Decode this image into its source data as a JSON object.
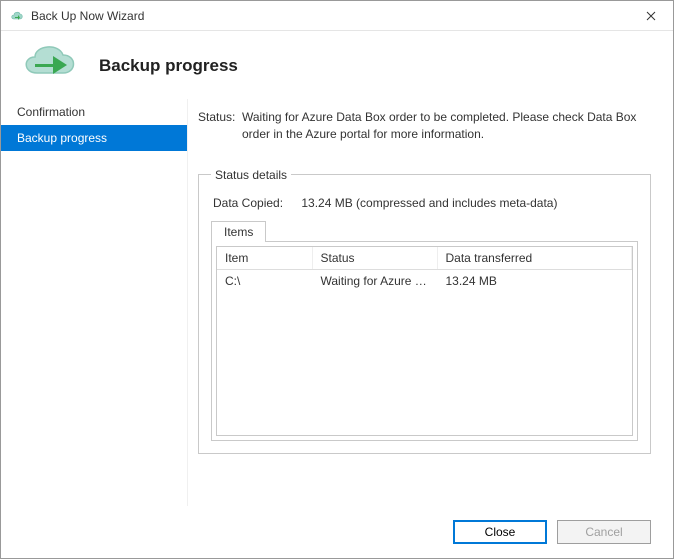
{
  "window": {
    "title": "Back Up Now Wizard"
  },
  "header": {
    "heading": "Backup progress"
  },
  "sidebar": {
    "items": [
      {
        "label": "Confirmation"
      },
      {
        "label": "Backup progress"
      }
    ],
    "active_index": 1
  },
  "status": {
    "label": "Status:",
    "value": "Waiting for Azure Data Box order to be completed. Please check Data Box order in the Azure portal for more information."
  },
  "details": {
    "legend": "Status details",
    "data_copied_label": "Data Copied:",
    "data_copied_value": "13.24 MB (compressed and includes meta-data)",
    "tab_label": "Items",
    "columns": {
      "item": "Item",
      "status": "Status",
      "transferred": "Data transferred"
    },
    "rows": [
      {
        "item": "C:\\",
        "status": "Waiting for Azure D...",
        "transferred": "13.24 MB"
      }
    ]
  },
  "footer": {
    "close_label": "Close",
    "cancel_label": "Cancel"
  },
  "colors": {
    "accent": "#0078d7",
    "cloud": "#9fd6c8",
    "arrow": "#3aa852"
  }
}
